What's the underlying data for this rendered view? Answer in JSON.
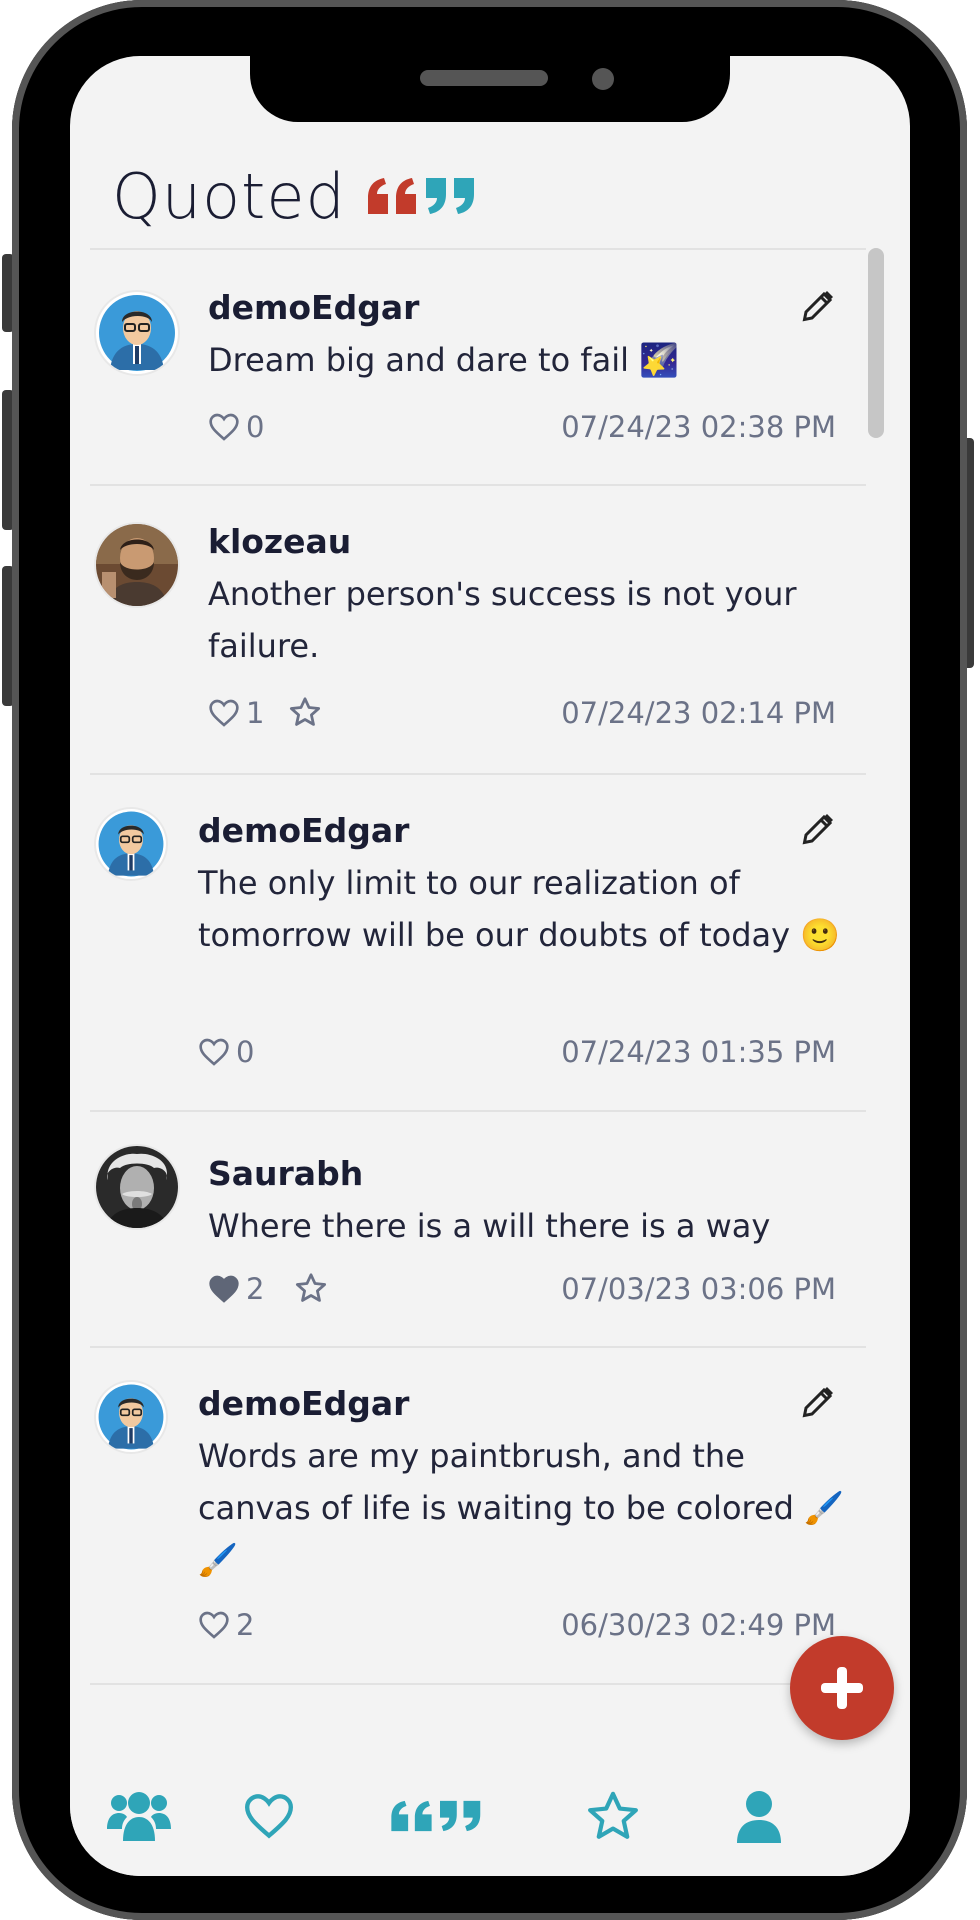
{
  "app": {
    "title": "Quoted"
  },
  "colors": {
    "accent": "#2fa5b8",
    "brand_red": "#c23b2b",
    "text": "#1a1d33",
    "muted": "#6b7287"
  },
  "posts": [
    {
      "user": "demoEdgar",
      "text": "Dream big and dare to fail 🌠",
      "likes": "0",
      "liked": false,
      "starrable": false,
      "editable": true,
      "timestamp": "07/24/23 02:38 PM",
      "avatar": "cartoon-man-avatar"
    },
    {
      "user": "klozeau",
      "text": "Another person's success is not your failure.",
      "likes": "1",
      "liked": false,
      "starrable": true,
      "editable": false,
      "timestamp": "07/24/23 02:14 PM",
      "avatar": "bearded-man-photo"
    },
    {
      "user": "demoEdgar",
      "text": "The only limit to our realization of tomorrow will be our doubts of today 🙂",
      "likes": "0",
      "liked": false,
      "starrable": false,
      "editable": true,
      "timestamp": "07/24/23 01:35 PM",
      "avatar": "cartoon-man-avatar"
    },
    {
      "user": "Saurabh",
      "text": "Where there is a will there is a way",
      "likes": "2",
      "liked": true,
      "starrable": true,
      "editable": false,
      "timestamp": "07/03/23 03:06 PM",
      "avatar": "einstein-photo"
    },
    {
      "user": "demoEdgar",
      "text": "Words are my paintbrush, and the canvas of life is waiting to be colored 🖌️ 🖌️",
      "likes": "2",
      "liked": false,
      "starrable": false,
      "editable": true,
      "timestamp": "06/30/23 02:49 PM",
      "avatar": "cartoon-man-avatar"
    }
  ],
  "tabs": [
    {
      "icon": "users-icon"
    },
    {
      "icon": "heart-icon"
    },
    {
      "icon": "quotes-icon"
    },
    {
      "icon": "star-icon"
    },
    {
      "icon": "user-icon"
    }
  ],
  "fab": {
    "icon": "plus-icon"
  }
}
